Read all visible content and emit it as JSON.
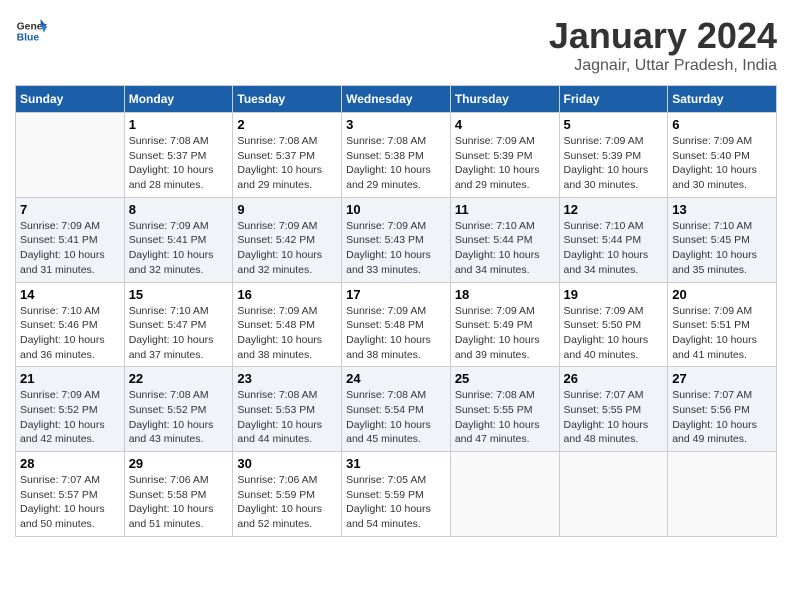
{
  "header": {
    "logo_line1": "General",
    "logo_line2": "Blue",
    "month": "January 2024",
    "location": "Jagnair, Uttar Pradesh, India"
  },
  "days_of_week": [
    "Sunday",
    "Monday",
    "Tuesday",
    "Wednesday",
    "Thursday",
    "Friday",
    "Saturday"
  ],
  "weeks": [
    [
      {
        "day": "",
        "info": ""
      },
      {
        "day": "1",
        "info": "Sunrise: 7:08 AM\nSunset: 5:37 PM\nDaylight: 10 hours\nand 28 minutes."
      },
      {
        "day": "2",
        "info": "Sunrise: 7:08 AM\nSunset: 5:37 PM\nDaylight: 10 hours\nand 29 minutes."
      },
      {
        "day": "3",
        "info": "Sunrise: 7:08 AM\nSunset: 5:38 PM\nDaylight: 10 hours\nand 29 minutes."
      },
      {
        "day": "4",
        "info": "Sunrise: 7:09 AM\nSunset: 5:39 PM\nDaylight: 10 hours\nand 29 minutes."
      },
      {
        "day": "5",
        "info": "Sunrise: 7:09 AM\nSunset: 5:39 PM\nDaylight: 10 hours\nand 30 minutes."
      },
      {
        "day": "6",
        "info": "Sunrise: 7:09 AM\nSunset: 5:40 PM\nDaylight: 10 hours\nand 30 minutes."
      }
    ],
    [
      {
        "day": "7",
        "info": "Sunrise: 7:09 AM\nSunset: 5:41 PM\nDaylight: 10 hours\nand 31 minutes."
      },
      {
        "day": "8",
        "info": "Sunrise: 7:09 AM\nSunset: 5:41 PM\nDaylight: 10 hours\nand 32 minutes."
      },
      {
        "day": "9",
        "info": "Sunrise: 7:09 AM\nSunset: 5:42 PM\nDaylight: 10 hours\nand 32 minutes."
      },
      {
        "day": "10",
        "info": "Sunrise: 7:09 AM\nSunset: 5:43 PM\nDaylight: 10 hours\nand 33 minutes."
      },
      {
        "day": "11",
        "info": "Sunrise: 7:10 AM\nSunset: 5:44 PM\nDaylight: 10 hours\nand 34 minutes."
      },
      {
        "day": "12",
        "info": "Sunrise: 7:10 AM\nSunset: 5:44 PM\nDaylight: 10 hours\nand 34 minutes."
      },
      {
        "day": "13",
        "info": "Sunrise: 7:10 AM\nSunset: 5:45 PM\nDaylight: 10 hours\nand 35 minutes."
      }
    ],
    [
      {
        "day": "14",
        "info": "Sunrise: 7:10 AM\nSunset: 5:46 PM\nDaylight: 10 hours\nand 36 minutes."
      },
      {
        "day": "15",
        "info": "Sunrise: 7:10 AM\nSunset: 5:47 PM\nDaylight: 10 hours\nand 37 minutes."
      },
      {
        "day": "16",
        "info": "Sunrise: 7:09 AM\nSunset: 5:48 PM\nDaylight: 10 hours\nand 38 minutes."
      },
      {
        "day": "17",
        "info": "Sunrise: 7:09 AM\nSunset: 5:48 PM\nDaylight: 10 hours\nand 38 minutes."
      },
      {
        "day": "18",
        "info": "Sunrise: 7:09 AM\nSunset: 5:49 PM\nDaylight: 10 hours\nand 39 minutes."
      },
      {
        "day": "19",
        "info": "Sunrise: 7:09 AM\nSunset: 5:50 PM\nDaylight: 10 hours\nand 40 minutes."
      },
      {
        "day": "20",
        "info": "Sunrise: 7:09 AM\nSunset: 5:51 PM\nDaylight: 10 hours\nand 41 minutes."
      }
    ],
    [
      {
        "day": "21",
        "info": "Sunrise: 7:09 AM\nSunset: 5:52 PM\nDaylight: 10 hours\nand 42 minutes."
      },
      {
        "day": "22",
        "info": "Sunrise: 7:08 AM\nSunset: 5:52 PM\nDaylight: 10 hours\nand 43 minutes."
      },
      {
        "day": "23",
        "info": "Sunrise: 7:08 AM\nSunset: 5:53 PM\nDaylight: 10 hours\nand 44 minutes."
      },
      {
        "day": "24",
        "info": "Sunrise: 7:08 AM\nSunset: 5:54 PM\nDaylight: 10 hours\nand 45 minutes."
      },
      {
        "day": "25",
        "info": "Sunrise: 7:08 AM\nSunset: 5:55 PM\nDaylight: 10 hours\nand 47 minutes."
      },
      {
        "day": "26",
        "info": "Sunrise: 7:07 AM\nSunset: 5:55 PM\nDaylight: 10 hours\nand 48 minutes."
      },
      {
        "day": "27",
        "info": "Sunrise: 7:07 AM\nSunset: 5:56 PM\nDaylight: 10 hours\nand 49 minutes."
      }
    ],
    [
      {
        "day": "28",
        "info": "Sunrise: 7:07 AM\nSunset: 5:57 PM\nDaylight: 10 hours\nand 50 minutes."
      },
      {
        "day": "29",
        "info": "Sunrise: 7:06 AM\nSunset: 5:58 PM\nDaylight: 10 hours\nand 51 minutes."
      },
      {
        "day": "30",
        "info": "Sunrise: 7:06 AM\nSunset: 5:59 PM\nDaylight: 10 hours\nand 52 minutes."
      },
      {
        "day": "31",
        "info": "Sunrise: 7:05 AM\nSunset: 5:59 PM\nDaylight: 10 hours\nand 54 minutes."
      },
      {
        "day": "",
        "info": ""
      },
      {
        "day": "",
        "info": ""
      },
      {
        "day": "",
        "info": ""
      }
    ]
  ]
}
